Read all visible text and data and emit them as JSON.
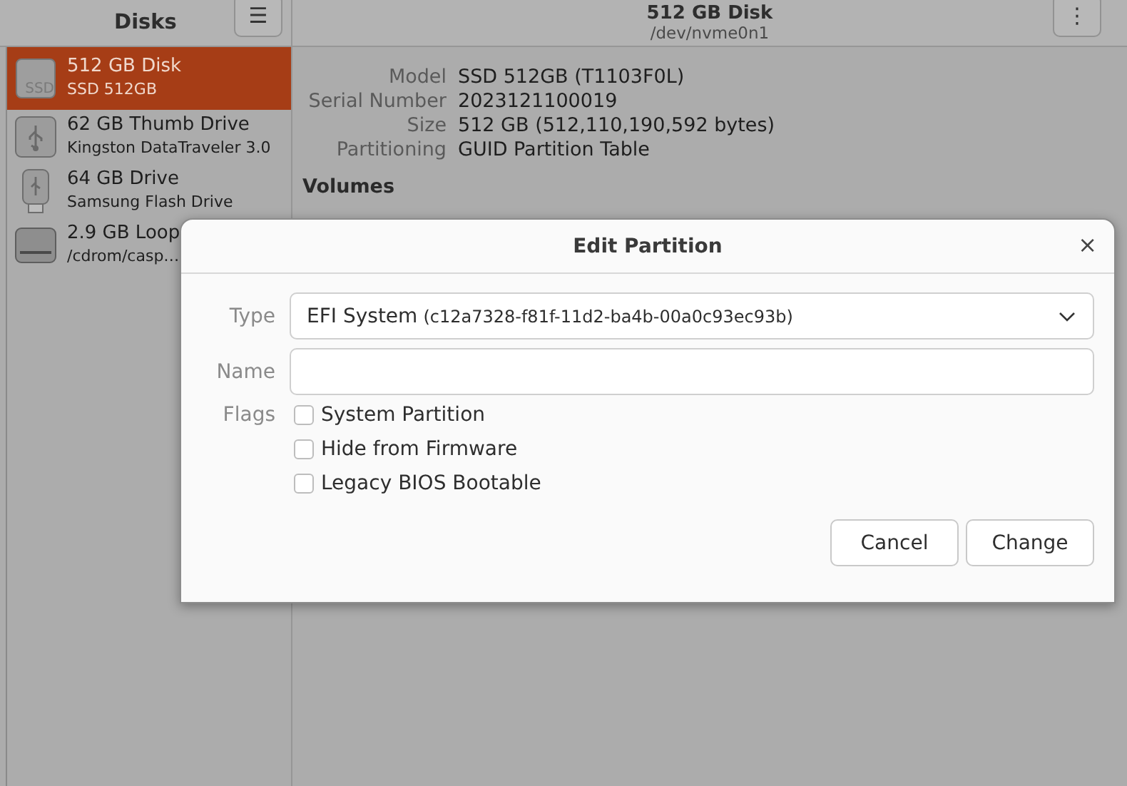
{
  "sidebar": {
    "title": "Disks",
    "menu_icon": "☰",
    "items": [
      {
        "kind": "ssd",
        "name": "512 GB Disk",
        "subtitle": "SSD 512GB",
        "selected": true,
        "icon_text": "SSD"
      },
      {
        "kind": "usb",
        "name": "62 GB Thumb Drive",
        "subtitle": "Kingston DataTraveler 3.0",
        "selected": false
      },
      {
        "kind": "usb-stick",
        "name": "64 GB Drive",
        "subtitle": "Samsung Flash Drive",
        "selected": false
      },
      {
        "kind": "loop",
        "name": "2.9 GB Loop",
        "subtitle": "/cdrom/casp…",
        "selected": false
      }
    ]
  },
  "details": {
    "title": "512 GB Disk",
    "subtitle": "/dev/nvme0n1",
    "menu_icon": "⋮",
    "fields": [
      {
        "label": "Model",
        "value": "SSD 512GB (T1103F0L)"
      },
      {
        "label": "Serial Number",
        "value": "2023121100019"
      },
      {
        "label": "Size",
        "value": "512 GB (512,110,190,592 bytes)"
      },
      {
        "label": "Partitioning",
        "value": "GUID Partition Table"
      }
    ],
    "volumes_heading": "Volumes"
  },
  "dialog": {
    "title": "Edit Partition",
    "close": "×",
    "type": {
      "label": "Type",
      "value": "EFI System",
      "detail": "(c12a7328-f81f-11d2-ba4b-00a0c93ec93b)"
    },
    "name": {
      "label": "Name"
    },
    "flags_label": "Flags",
    "flags": [
      {
        "label": "System Partition",
        "checked": false
      },
      {
        "label": "Hide from Firmware",
        "checked": false
      },
      {
        "label": "Legacy BIOS Bootable",
        "checked": false
      }
    ],
    "buttons": [
      "Cancel",
      "Change"
    ]
  }
}
